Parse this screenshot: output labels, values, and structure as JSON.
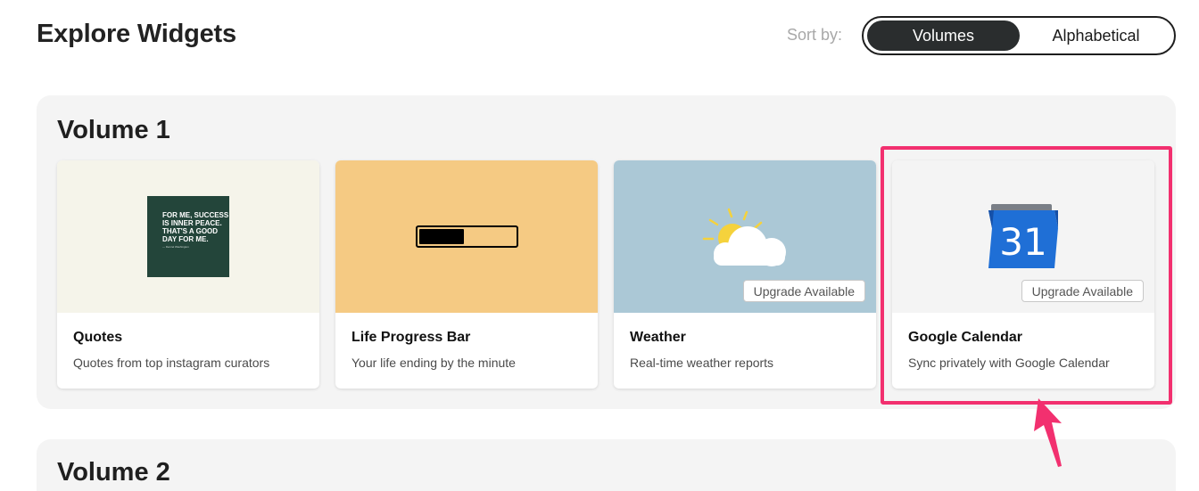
{
  "header": {
    "title": "Explore Widgets",
    "sort_label": "Sort by:",
    "sort_options": [
      {
        "label": "Volumes",
        "active": true
      },
      {
        "label": "Alphabetical",
        "active": false
      }
    ]
  },
  "volumes": [
    {
      "title": "Volume 1",
      "widgets": [
        {
          "title": "Quotes",
          "description": "Quotes from top instagram curators",
          "thumb_bg": "#f5f4ea",
          "quote_text": "FOR ME, SUCCESS IS INNER PEACE. THAT'S A GOOD DAY FOR ME.",
          "quote_author": "— Denzel Washington",
          "icon": "quote-card-icon"
        },
        {
          "title": "Life Progress Bar",
          "description": "Your life ending by the minute",
          "thumb_bg": "#f5ca83",
          "progress_fraction": 0.47,
          "icon": "progress-bar-icon"
        },
        {
          "title": "Weather",
          "description": "Real-time weather reports",
          "thumb_bg": "#abc8d6",
          "badge": "Upgrade Available",
          "icon": "sun-cloud-icon"
        },
        {
          "title": "Google Calendar",
          "description": "Sync privately with Google Calendar",
          "thumb_bg": "#f4f4f4",
          "badge": "Upgrade Available",
          "calendar_day": "31",
          "icon": "google-calendar-icon"
        }
      ]
    },
    {
      "title": "Volume 2"
    }
  ],
  "colors": {
    "annotation": "#f2306f",
    "toggle_active": "#2a2d2e",
    "panel_bg": "#f4f4f4"
  }
}
